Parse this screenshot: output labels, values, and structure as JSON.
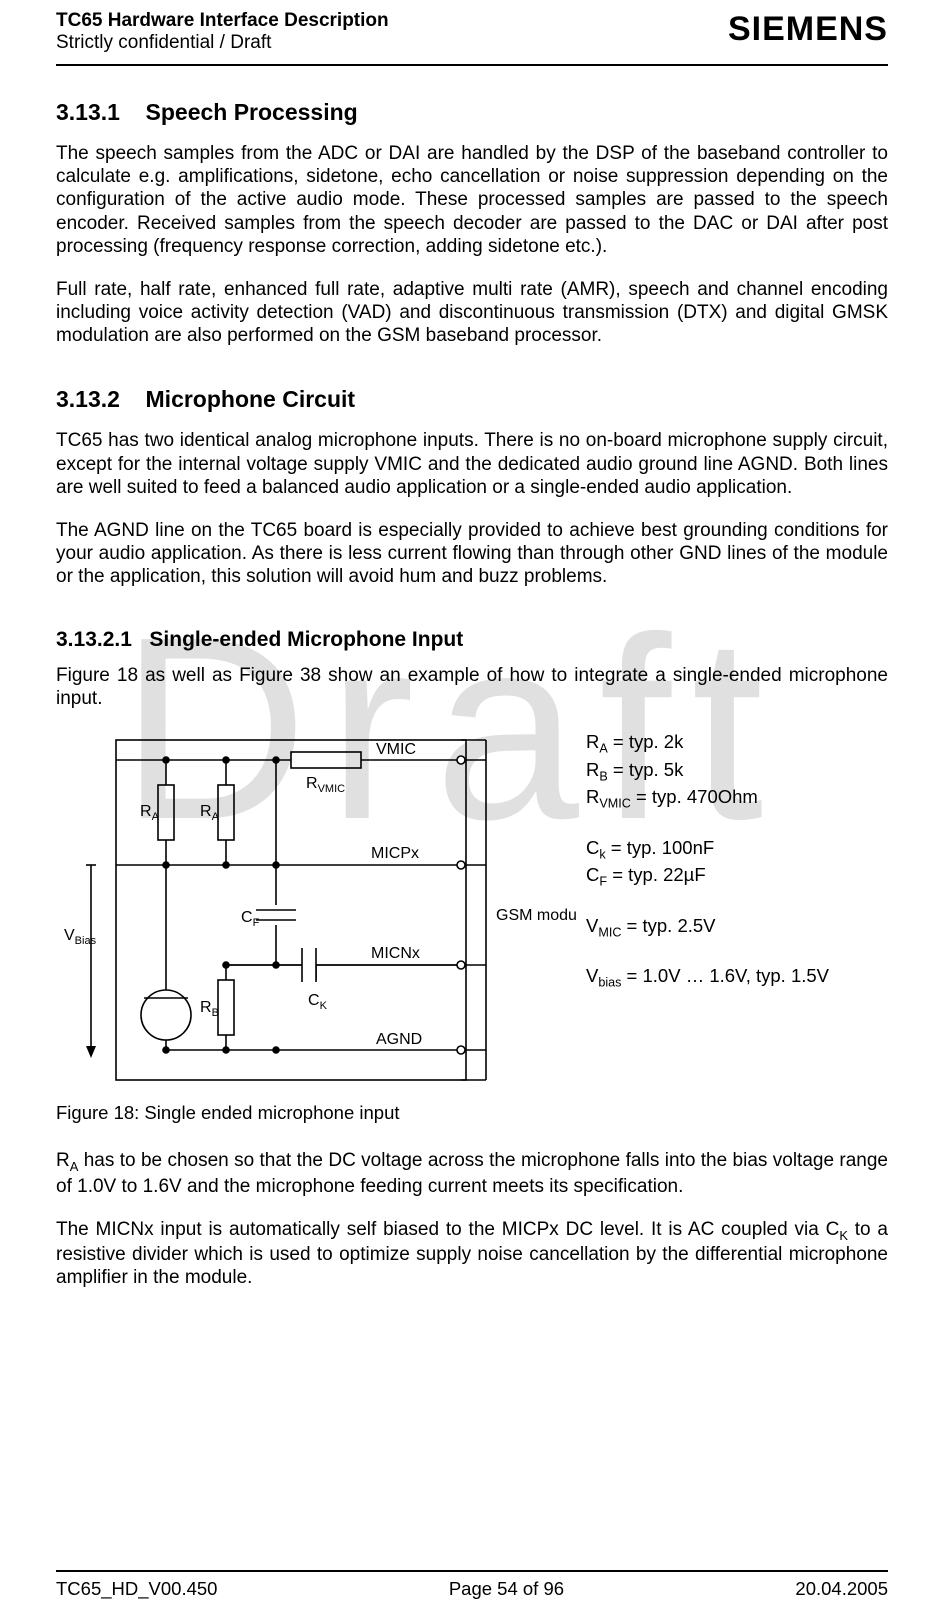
{
  "header": {
    "title": "TC65 Hardware Interface Description",
    "subtitle": "Strictly confidential / Draft",
    "logo": "SIEMENS"
  },
  "watermark": "Draft",
  "sections": {
    "s1": {
      "num": "3.13.1",
      "title": "Speech Processing",
      "p1": "The speech samples from the ADC or DAI are handled by the DSP of the baseband controller to calculate e.g. amplifications, sidetone, echo cancellation or noise suppression depending on the configuration of the active audio mode. These processed samples are passed to the speech encoder. Received samples from the speech decoder are passed to the DAC or DAI after post processing (frequency response correction, adding sidetone etc.).",
      "p2": "Full rate, half rate, enhanced full rate, adaptive multi rate (AMR), speech and channel encoding including voice activity detection (VAD) and discontinuous transmission (DTX) and digital GMSK modulation are also performed on the GSM baseband processor."
    },
    "s2": {
      "num": "3.13.2",
      "title": "Microphone Circuit",
      "p1": "TC65 has two identical analog microphone inputs. There is no on-board microphone supply circuit, except for the internal voltage supply VMIC and the dedicated audio ground line AGND. Both lines are well suited to feed a balanced audio application or a single-ended audio application.",
      "p2": "The AGND line on the TC65 board is especially provided to achieve best grounding conditions for your audio application. As there is less current flowing than through other GND lines of the module or the application, this solution will avoid hum and buzz problems."
    },
    "s3": {
      "num": "3.13.2.1",
      "title": "Single-ended Microphone Input",
      "p1": "Figure 18 as well as Figure 38 show an example of how to integrate a single-ended microphone input."
    },
    "after": {
      "p1_a": "R",
      "p1_b": " has to be chosen so that the DC voltage across the microphone falls into the bias voltage range of 1.0V to 1.6V and the microphone feeding current meets its specification.",
      "p2_a": "The MICNx input is automatically self biased to the MICPx DC level. It is AC coupled via C",
      "p2_b": " to a resistive divider which is used to optimize supply noise cancellation by the differential microphone amplifier in the module."
    }
  },
  "figure": {
    "caption": "Figure 18: Single ended microphone input",
    "labels": {
      "vmic": "VMIC",
      "rvmic": "R",
      "rvmic_sub": "VMIC",
      "ra": "R",
      "ra_sub": "A",
      "micpx": "MICPx",
      "cf": "C",
      "cf_sub": "F",
      "gsm": "GSM module",
      "vbias": "V",
      "vbias_sub": "Bias",
      "micnx": "MICNx",
      "ck": "C",
      "ck_sub": "K",
      "rb": "R",
      "rb_sub": "B",
      "agnd": "AGND"
    },
    "params": {
      "ra": "R",
      "ra_val": " = typ. 2k",
      "rb": "R",
      "rb_val": " = typ. 5k",
      "rvmic": "R",
      "rvmic_val": " = typ. 470Ohm",
      "ck": "C",
      "ck_val": " = typ. 100nF",
      "cf": "C",
      "cf_val": " = typ. 22µF",
      "vmic": "V",
      "vmic_val": " = typ. 2.5V",
      "vbias": "V",
      "vbias_val": " = 1.0V … 1.6V, typ. 1.5V"
    }
  },
  "footer": {
    "left": "TC65_HD_V00.450",
    "center": "Page 54 of 96",
    "right": "20.04.2005"
  }
}
